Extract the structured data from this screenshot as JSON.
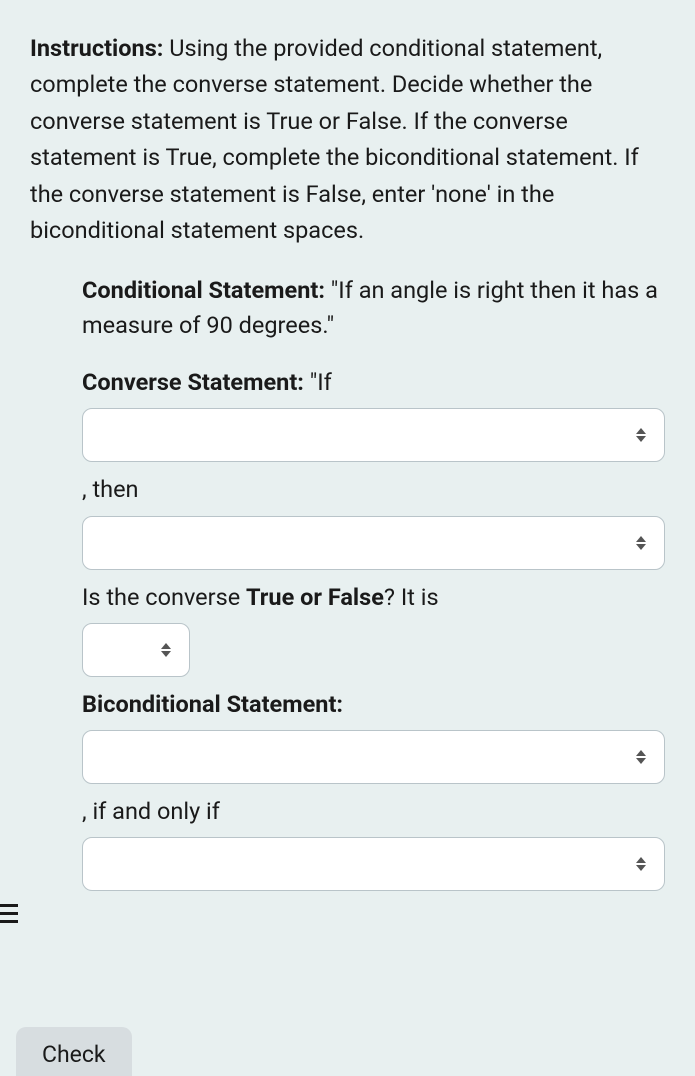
{
  "instructions": {
    "label": "Instructions:",
    "text": " Using the provided conditional statement, complete the converse statement. Decide whether the converse statement is True or False. If the converse statement is True, complete the biconditional statement. If the converse statement is False, enter 'none' in the biconditional statement spaces."
  },
  "conditional": {
    "label": "Conditional Statement:",
    "text": " \"If an angle is right then it has a measure of 90 degrees.\""
  },
  "converse": {
    "label": "Converse Statement:",
    "lead": " \"If",
    "select1_value": "",
    "then_text": ", then",
    "select2_value": ""
  },
  "truefalse": {
    "question_pre": "Is the converse ",
    "question_bold": "True or False",
    "question_post": "? It is",
    "select_value": ""
  },
  "biconditional": {
    "label": "Biconditional Statement:",
    "select1_value": "",
    "iff_text": ", if and only if",
    "select2_value": ""
  },
  "check_button": "Check"
}
